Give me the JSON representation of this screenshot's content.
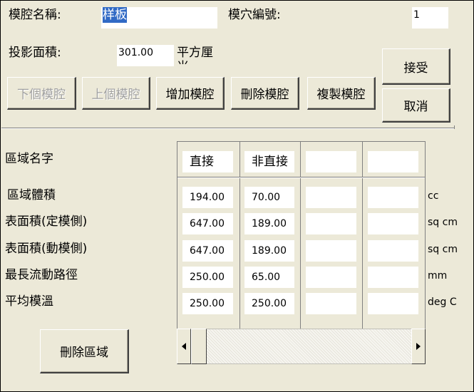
{
  "form": {
    "cavity_name_label": "模腔名稱:",
    "cavity_name_value": "样板",
    "cavity_number_label": "模穴編號:",
    "cavity_number_value": "1",
    "projected_area_label": "投影面積:",
    "projected_area_value": "301.00",
    "projected_area_unit": "平方厘米"
  },
  "buttons": {
    "accept": "接受",
    "cancel": "取消",
    "next_cavity": "下個模腔",
    "prev_cavity": "上個模腔",
    "add_cavity": "增加模腔",
    "delete_cavity": "刪除模腔",
    "copy_cavity": "複製模腔",
    "delete_region": "刪除區域"
  },
  "grid": {
    "region_name_label": "區域名字",
    "columns": [
      "直接",
      "非直接",
      "",
      ""
    ],
    "rows": [
      {
        "label": "區域體積",
        "values": [
          "194.00",
          "70.00",
          "",
          ""
        ],
        "unit": "cc"
      },
      {
        "label": "表面積(定模側)",
        "values": [
          "647.00",
          "189.00",
          "",
          ""
        ],
        "unit": "sq cm"
      },
      {
        "label": "表面積(動模側)",
        "values": [
          "647.00",
          "189.00",
          "",
          ""
        ],
        "unit": "sq cm"
      },
      {
        "label": "最長流動路徑",
        "values": [
          "250.00",
          "65.00",
          "",
          ""
        ],
        "unit": "mm"
      },
      {
        "label": "平均模溫",
        "values": [
          "250.00",
          "250.00",
          "",
          ""
        ],
        "unit": "deg C"
      }
    ]
  },
  "scrollbar": {
    "left_arrow_icon": "triangle-left",
    "right_arrow_icon": "triangle-right"
  }
}
